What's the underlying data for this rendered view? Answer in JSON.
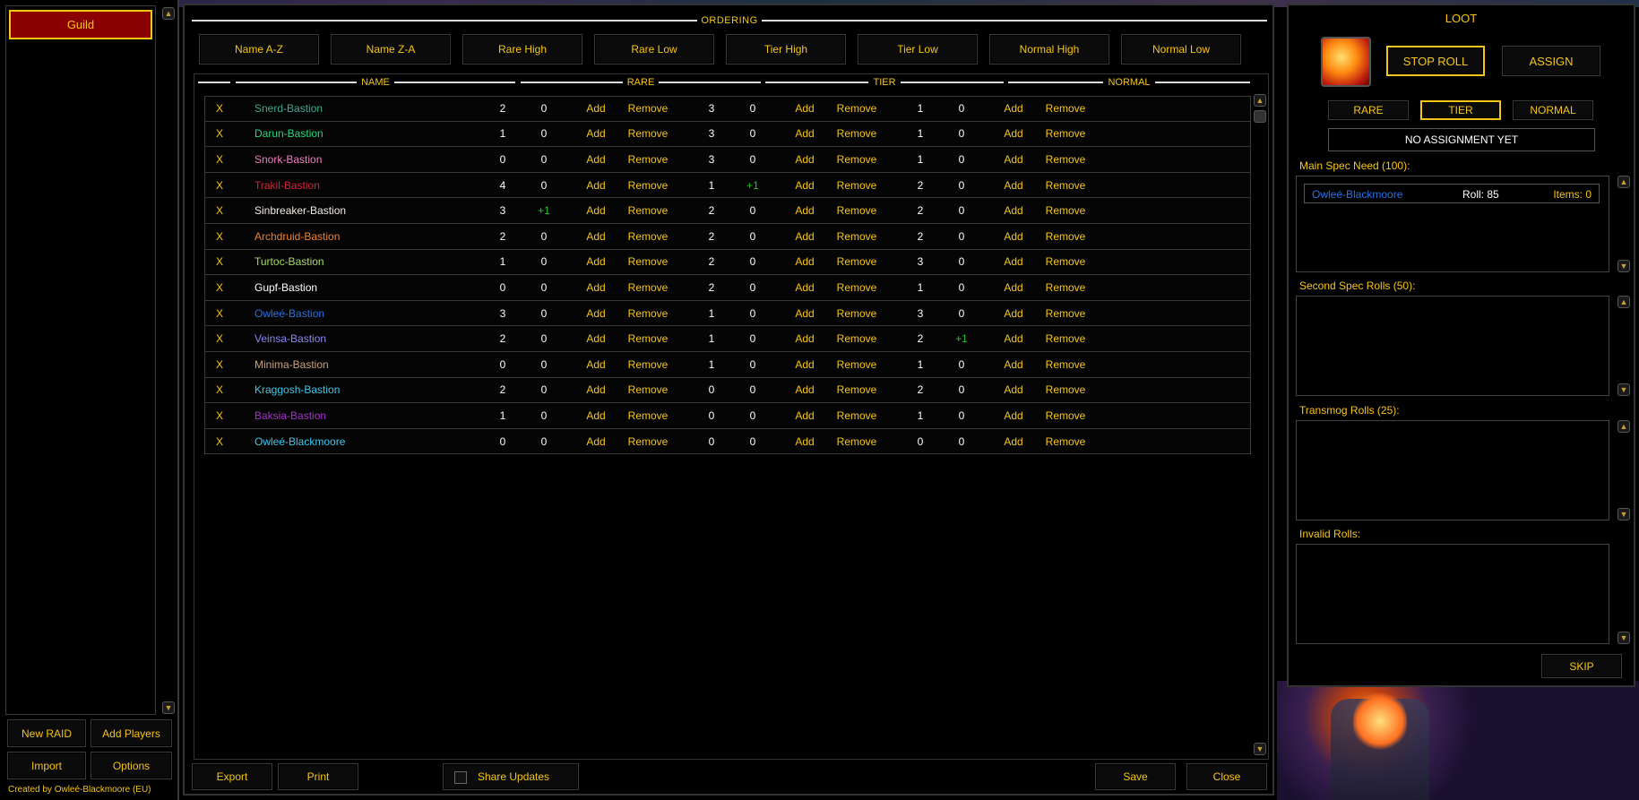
{
  "left": {
    "guild_tab": "Guild",
    "new_raid": "New RAID",
    "add_players": "Add Players",
    "import": "Import",
    "options": "Options",
    "credit": "Created by Owleé-Blackmoore (EU)"
  },
  "main": {
    "ordering_title": "ORDERING",
    "ordering_buttons": [
      "Name A-Z",
      "Name Z-A",
      "Rare High",
      "Rare Low",
      "Tier High",
      "Tier Low",
      "Normal High",
      "Normal Low"
    ],
    "columns": {
      "name": "NAME",
      "rare": "RARE",
      "tier": "TIER",
      "normal": "NORMAL"
    },
    "remove_x": "X",
    "add_label": "Add",
    "remove_label": "Remove",
    "players": [
      {
        "name": "Snerd-Bastion",
        "color": "#3fa88e",
        "rare": "2",
        "rare_mod": "0",
        "tier": "3",
        "tier_mod": "0",
        "normal": "1",
        "normal_mod": "0"
      },
      {
        "name": "Darun-Bastion",
        "color": "#28d880",
        "rare": "1",
        "rare_mod": "0",
        "tier": "3",
        "tier_mod": "0",
        "normal": "1",
        "normal_mod": "0"
      },
      {
        "name": "Snork-Bastion",
        "color": "#ef7fc0",
        "rare": "0",
        "rare_mod": "0",
        "tier": "3",
        "tier_mod": "0",
        "normal": "1",
        "normal_mod": "0"
      },
      {
        "name": "Trakil-Bastion",
        "color": "#c8283c",
        "rare": "4",
        "rare_mod": "0",
        "tier": "1",
        "tier_mod": "+1",
        "normal": "2",
        "normal_mod": "0"
      },
      {
        "name": "Sinbreaker-Bastion",
        "color": "#f0ece0",
        "rare": "3",
        "rare_mod": "+1",
        "tier": "2",
        "tier_mod": "0",
        "normal": "2",
        "normal_mod": "0"
      },
      {
        "name": "Archdruid-Bastion",
        "color": "#f0802a",
        "rare": "2",
        "rare_mod": "0",
        "tier": "2",
        "tier_mod": "0",
        "normal": "2",
        "normal_mod": "0"
      },
      {
        "name": "Turtoc-Bastion",
        "color": "#a8d86c",
        "rare": "1",
        "rare_mod": "0",
        "tier": "2",
        "tier_mod": "0",
        "normal": "3",
        "normal_mod": "0"
      },
      {
        "name": "Gupf-Bastion",
        "color": "#ffffff",
        "rare": "0",
        "rare_mod": "0",
        "tier": "2",
        "tier_mod": "0",
        "normal": "1",
        "normal_mod": "0"
      },
      {
        "name": "Owleé-Bastion",
        "color": "#2a70e0",
        "rare": "3",
        "rare_mod": "0",
        "tier": "1",
        "tier_mod": "0",
        "normal": "3",
        "normal_mod": "0"
      },
      {
        "name": "Veinsa-Bastion",
        "color": "#8a88ec",
        "rare": "2",
        "rare_mod": "0",
        "tier": "1",
        "tier_mod": "0",
        "normal": "2",
        "normal_mod": "+1"
      },
      {
        "name": "Minima-Bastion",
        "color": "#c8a27c",
        "rare": "0",
        "rare_mod": "0",
        "tier": "1",
        "tier_mod": "0",
        "normal": "1",
        "normal_mod": "0"
      },
      {
        "name": "Kraggosh-Bastion",
        "color": "#3ec6ea",
        "rare": "2",
        "rare_mod": "0",
        "tier": "0",
        "tier_mod": "0",
        "normal": "2",
        "normal_mod": "0"
      },
      {
        "name": "Baksia-Bastion",
        "color": "#a330c9",
        "rare": "1",
        "rare_mod": "0",
        "tier": "0",
        "tier_mod": "0",
        "normal": "1",
        "normal_mod": "0"
      },
      {
        "name": "Owleé-Blackmoore",
        "color": "#3ec6ea",
        "rare": "0",
        "rare_mod": "0",
        "tier": "0",
        "tier_mod": "0",
        "normal": "0",
        "normal_mod": "0"
      }
    ],
    "export": "Export",
    "print": "Print",
    "share_updates": "Share Updates",
    "save": "Save",
    "close": "Close"
  },
  "loot": {
    "title": "LOOT",
    "stop_roll": "STOP ROLL",
    "assign": "ASSIGN",
    "tabs": [
      "RARE",
      "TIER",
      "NORMAL"
    ],
    "active_tab": "TIER",
    "assign_status": "NO ASSIGNMENT YET",
    "main_spec_label": "Main Spec Need (100):",
    "main_spec_roll": {
      "player": "Owleé-Blackmoore",
      "roll": "Roll: 85",
      "items": "Items: 0",
      "color": "#2a70e0"
    },
    "second_spec_label": "Second Spec Rolls (50):",
    "transmog_label": "Transmog Rolls (25):",
    "invalid_label": "Invalid Rolls:",
    "skip": "SKIP"
  }
}
